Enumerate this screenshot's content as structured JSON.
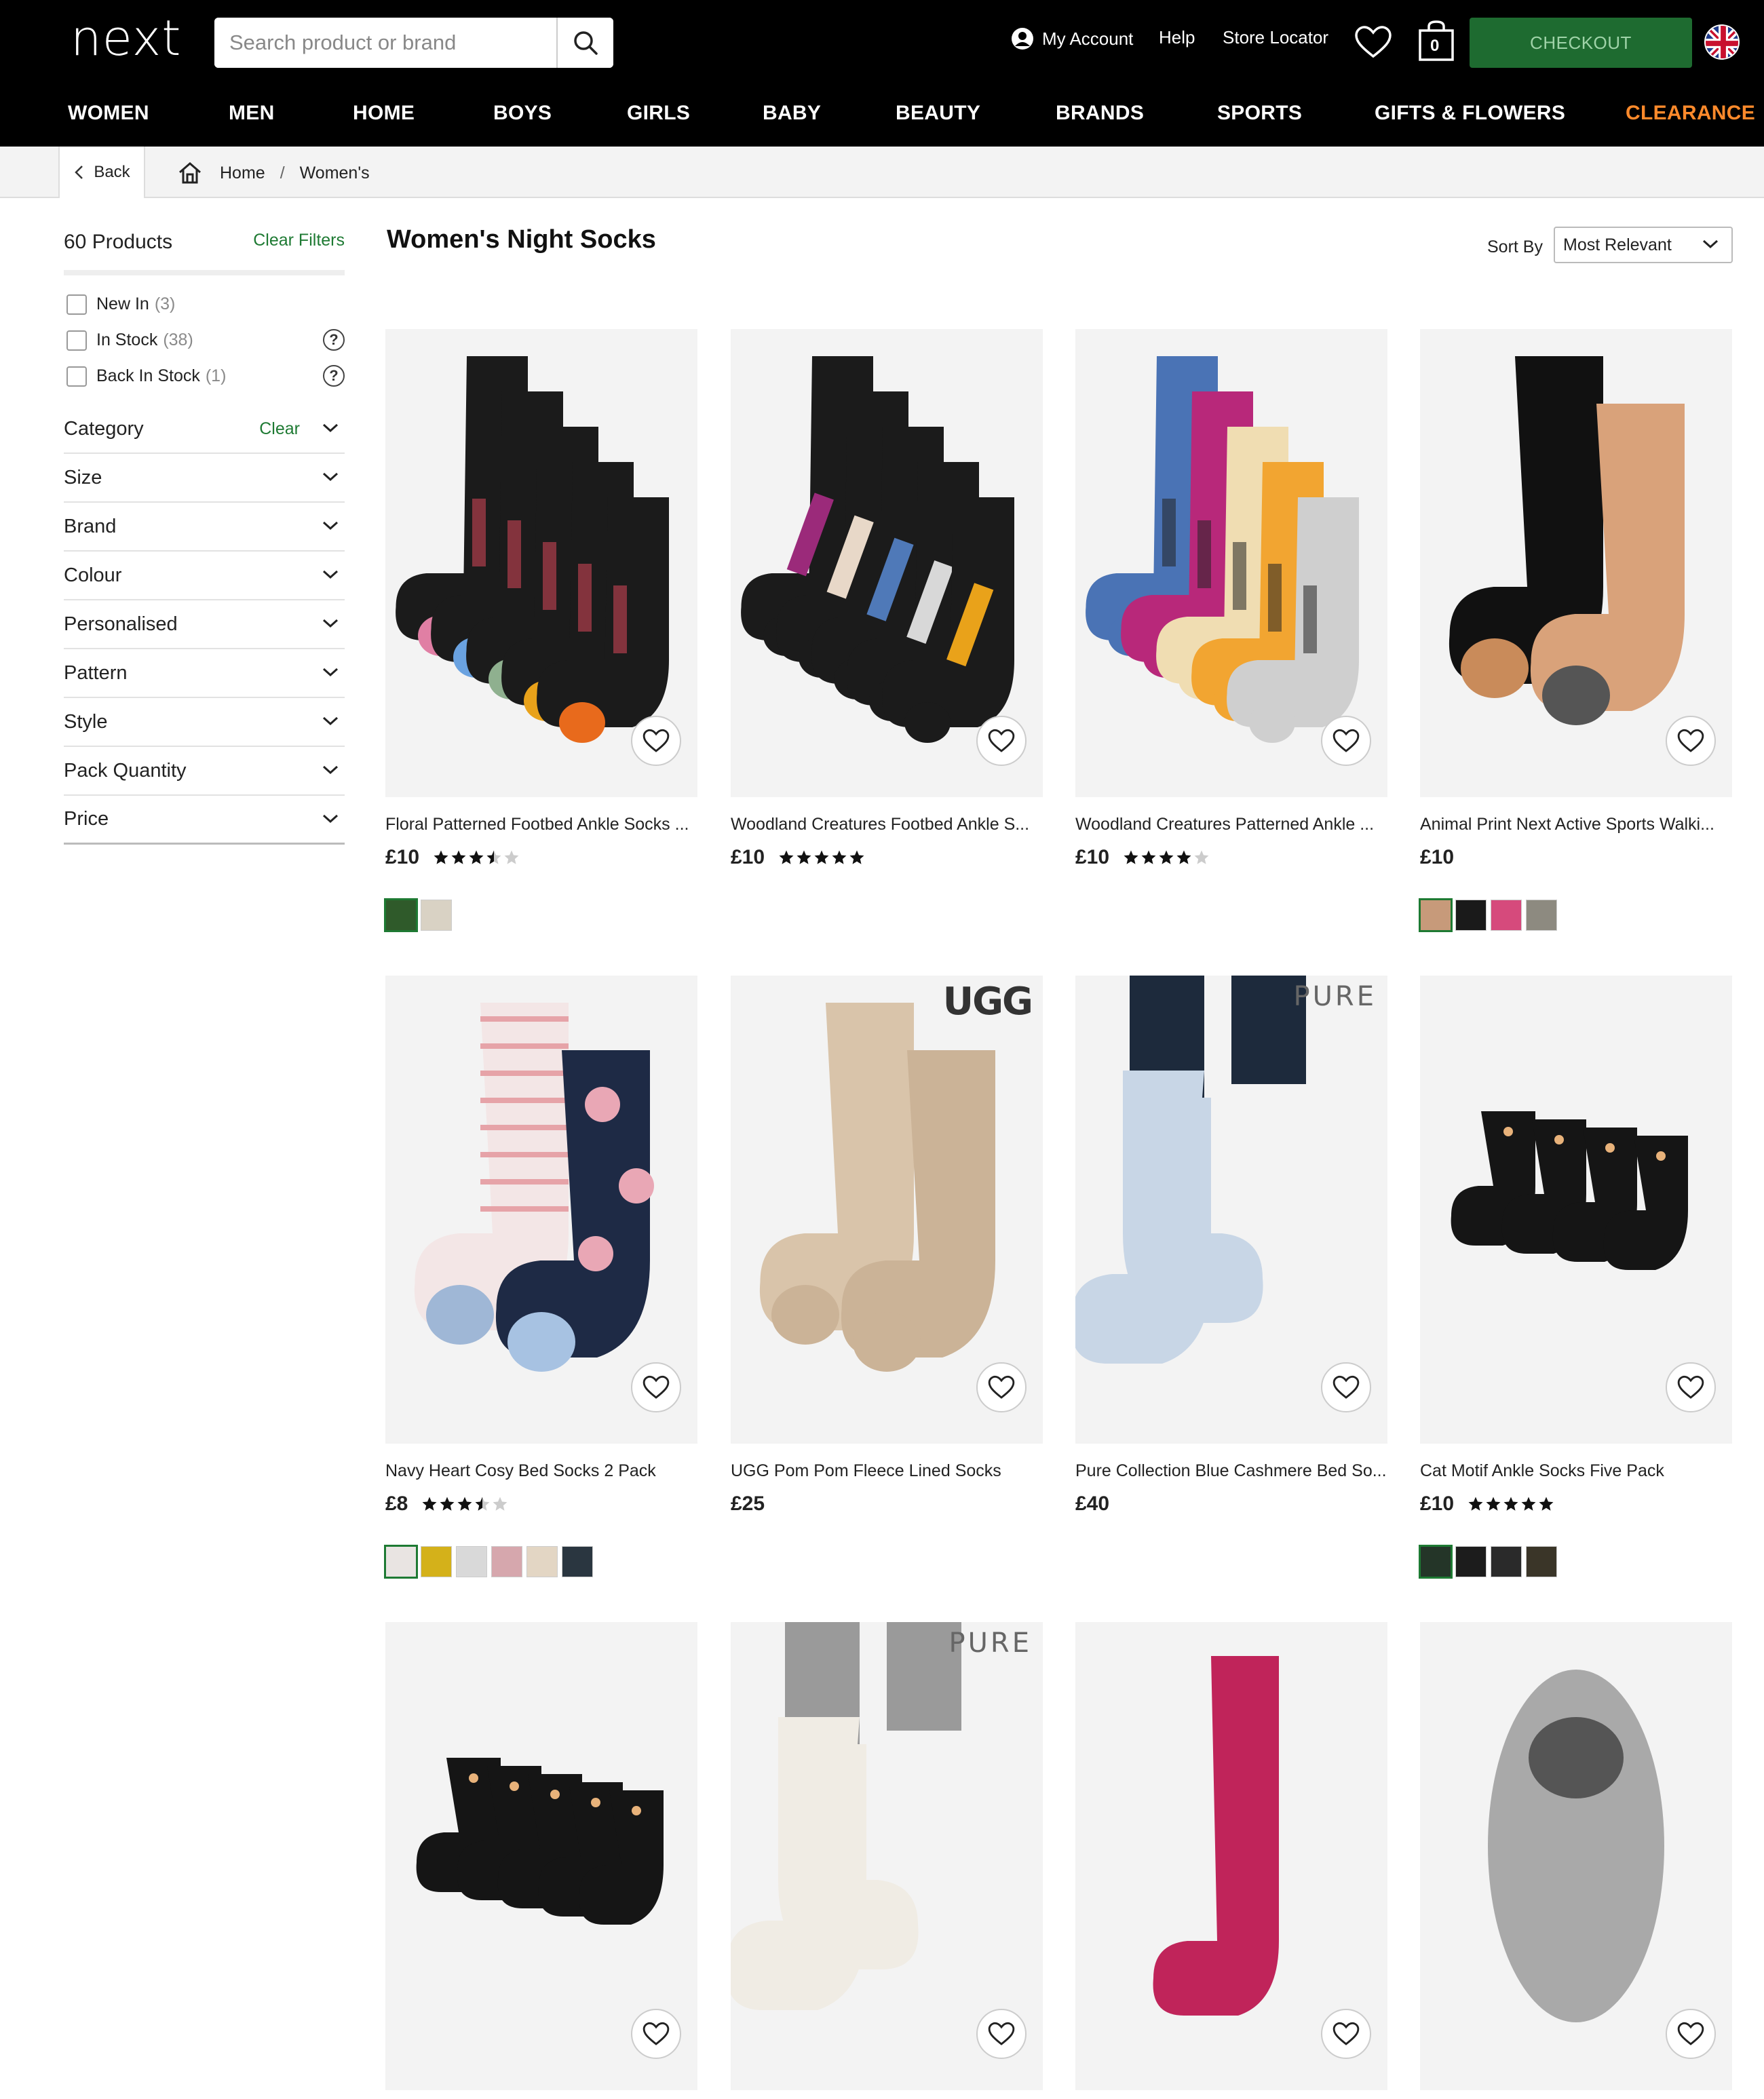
{
  "header": {
    "logo": "next",
    "search_placeholder": "Search product or brand",
    "my_account": "My Account",
    "help": "Help",
    "store_locator": "Store Locator",
    "bag_count": "0",
    "checkout": "CHECKOUT"
  },
  "nav": [
    "WOMEN",
    "MEN",
    "HOME",
    "BOYS",
    "GIRLS",
    "BABY",
    "BEAUTY",
    "BRANDS",
    "SPORTS",
    "GIFTS & FLOWERS",
    "CLEARANCE"
  ],
  "breadcrumb": {
    "back": "Back",
    "home": "Home",
    "sep": "/",
    "current": "Women's"
  },
  "sidebar": {
    "count": "60 Products",
    "clear_filters": "Clear Filters",
    "checks": [
      {
        "label": "New In",
        "count": "(3)"
      },
      {
        "label": "In Stock",
        "count": "(38)"
      },
      {
        "label": "Back In Stock",
        "count": "(1)"
      }
    ],
    "facets": [
      "Category",
      "Size",
      "Brand",
      "Colour",
      "Personalised",
      "Pattern",
      "Style",
      "Pack Quantity",
      "Price"
    ],
    "category_clear": "Clear"
  },
  "main": {
    "title": "Women's Night Socks",
    "sort_label": "Sort By",
    "sort_value": "Most Relevant"
  },
  "products": [
    {
      "name": "Floral Patterned Footbed Ankle Socks ...",
      "price": "£10",
      "rating": 3.5,
      "swatch_colors": [
        "#2f5a2a",
        "#d9d2c4"
      ]
    },
    {
      "name": "Woodland Creatures Footbed Ankle S...",
      "price": "£10",
      "rating": 5
    },
    {
      "name": "Woodland Creatures Patterned Ankle ...",
      "price": "£10",
      "rating": 4
    },
    {
      "name": "Animal Print Next Active Sports Walki...",
      "price": "£10",
      "swatch_colors": [
        "#c79a7a",
        "#1a1a1a",
        "#d64a7c",
        "#8d8a80"
      ]
    },
    {
      "name": "Navy Heart Cosy Bed Socks 2 Pack",
      "price": "£8",
      "rating": 3.5,
      "swatch_colors": [
        "#e9e4e2",
        "#d4b11a",
        "#d9d9d9",
        "#d6a7ad",
        "#e3d6c4",
        "#2a3640"
      ]
    },
    {
      "name": "UGG Pom Pom Fleece Lined Socks",
      "price": "£25",
      "brand": "UGG"
    },
    {
      "name": "Pure Collection Blue Cashmere Bed So...",
      "price": "£40",
      "brand": "PURE"
    },
    {
      "name": "Cat Motif Ankle Socks Five Pack",
      "price": "£10",
      "rating": 5,
      "swatch_colors": [
        "#243528",
        "#1c1c1c",
        "#2a2a2a",
        "#3a3528"
      ]
    },
    {
      "name": "",
      "price": ""
    },
    {
      "name": "",
      "price": "",
      "brand": "PURE"
    },
    {
      "name": "",
      "price": ""
    },
    {
      "name": "",
      "price": ""
    }
  ],
  "colors": {
    "checkout": "#1e6b30",
    "clearance": "#ff8a2b",
    "link_green": "#1e7a33"
  }
}
